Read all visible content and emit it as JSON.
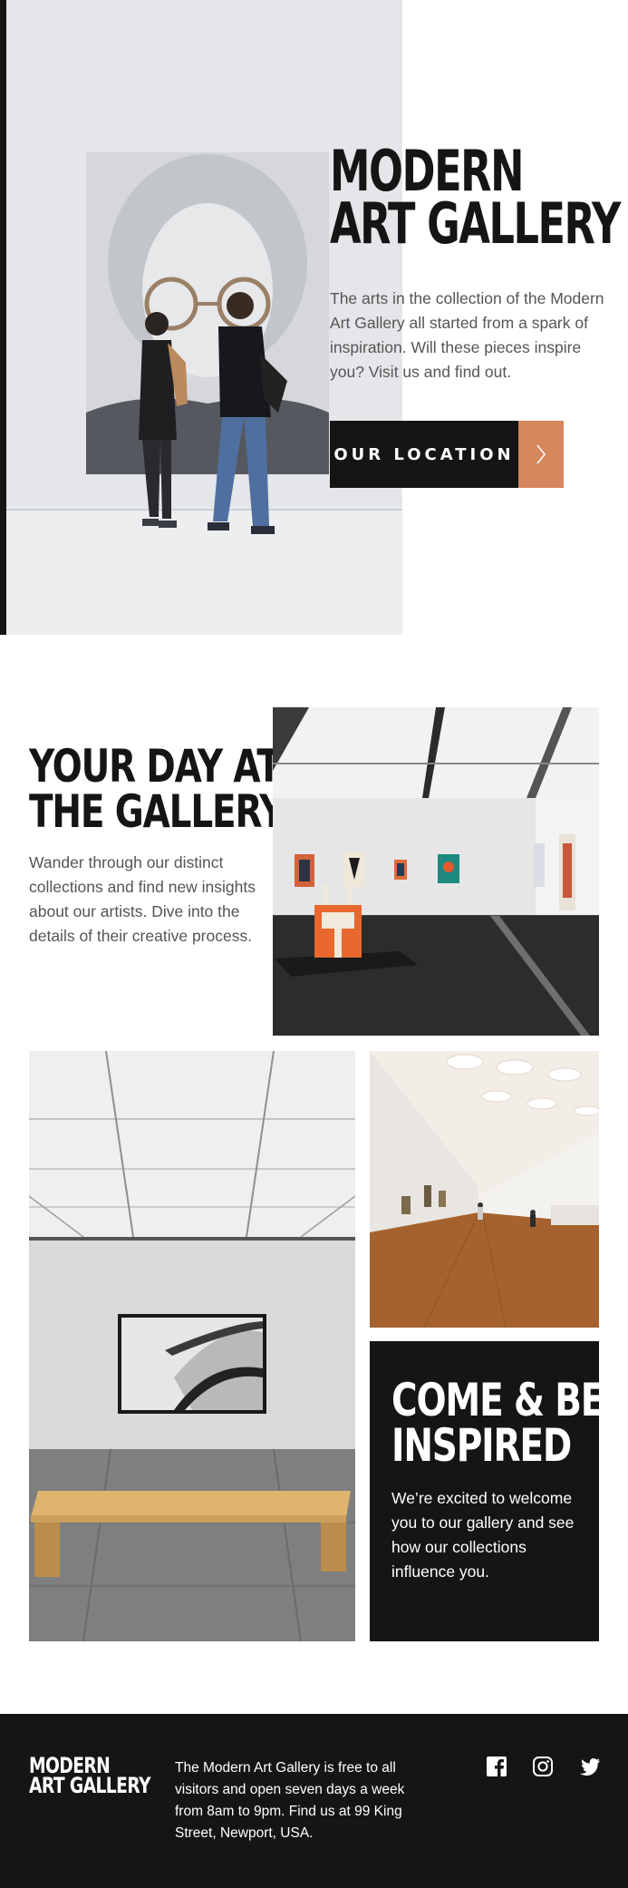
{
  "hero": {
    "title_line1": "Modern",
    "title_line2": "Art Gallery",
    "description": "The arts in the collection of the Modern Art Gallery all started from a spark of inspiration. Will these pieces inspire you? Visit us and find out.",
    "button_label": "OUR LOCATION",
    "button_icon": "chevron-right-icon"
  },
  "day": {
    "title_line1": "Your Day at",
    "title_line2": "the Gallery",
    "description": "Wander through our distinct collections and find new insights about our artists. Dive into the details of their creative process."
  },
  "inspired": {
    "title_line1": "Come & Be",
    "title_line2": "Inspired",
    "description": "We’re excited to welcome you to our gallery and see how our collections influence you."
  },
  "footer": {
    "logo_line1": "Modern",
    "logo_line2": "Art Gallery",
    "info": "The Modern Art Gallery is free to all visitors and open seven days a week from 8am to 9pm. Find us at 99 King Street, Newport, USA.",
    "social_icons": [
      "facebook-icon",
      "instagram-icon",
      "twitter-icon"
    ]
  },
  "colors": {
    "dark": "#151515",
    "accent": "#d5875e",
    "body_text": "#555555",
    "white": "#ffffff"
  }
}
